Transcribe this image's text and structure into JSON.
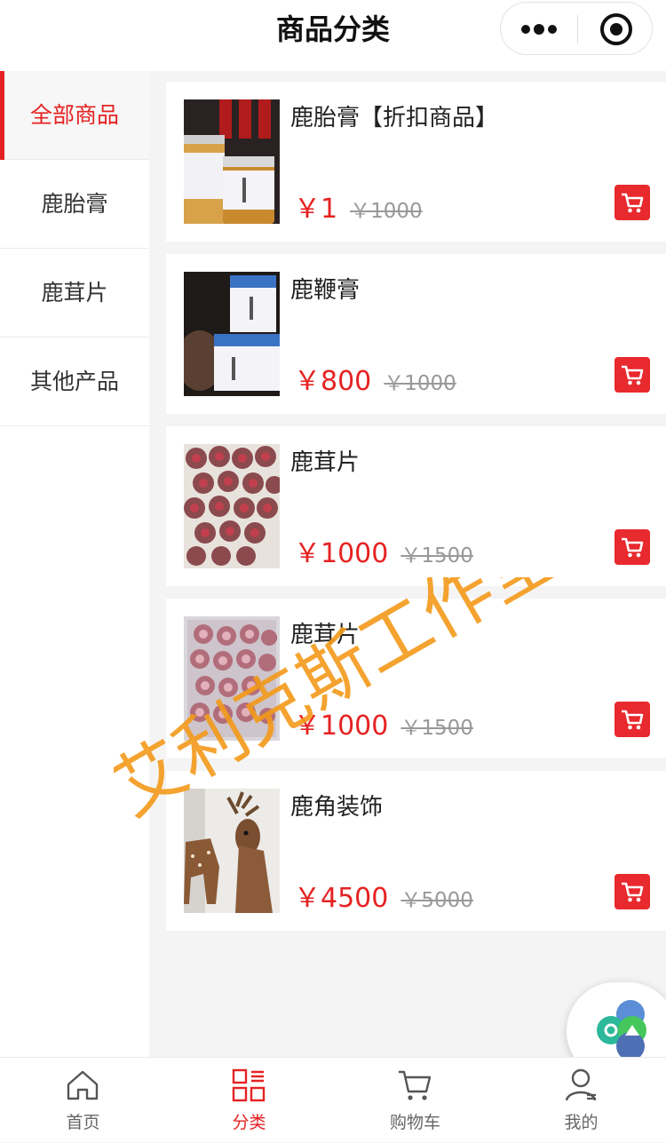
{
  "header": {
    "title": "商品分类",
    "more_icon": "more-dots-icon",
    "close_icon": "target-circle-icon"
  },
  "sidebar": {
    "items": [
      {
        "label": "全部商品",
        "active": true
      },
      {
        "label": "鹿胎膏",
        "active": false
      },
      {
        "label": "鹿茸片",
        "active": false
      },
      {
        "label": "其他产品",
        "active": false
      }
    ]
  },
  "products": [
    {
      "title": "鹿胎膏【折扣商品】",
      "price": "￥1",
      "original_price": "￥1000",
      "image": "jars-amber"
    },
    {
      "title": "鹿鞭膏",
      "price": "￥800",
      "original_price": "￥1000",
      "image": "jars-blue"
    },
    {
      "title": "鹿茸片",
      "price": "￥1000",
      "original_price": "￥1500",
      "image": "antler-slices"
    },
    {
      "title": "鹿茸片",
      "price": "￥1000",
      "original_price": "￥1500",
      "image": "antler-slices-bagged"
    },
    {
      "title": "鹿角装饰",
      "price": "￥4500",
      "original_price": "￥5000",
      "image": "deer-head"
    }
  ],
  "tabbar": {
    "items": [
      {
        "label": "首页",
        "icon": "home-icon",
        "active": false
      },
      {
        "label": "分类",
        "icon": "category-grid-icon",
        "active": true
      },
      {
        "label": "购物车",
        "icon": "cart-icon",
        "active": false
      },
      {
        "label": "我的",
        "icon": "user-icon",
        "active": false
      }
    ]
  },
  "watermark": "艾利克斯工作室",
  "colors": {
    "accent": "#e52222",
    "cart_button": "#e8292e",
    "watermark": "#f39a1a",
    "background": "#f4f4f4"
  }
}
